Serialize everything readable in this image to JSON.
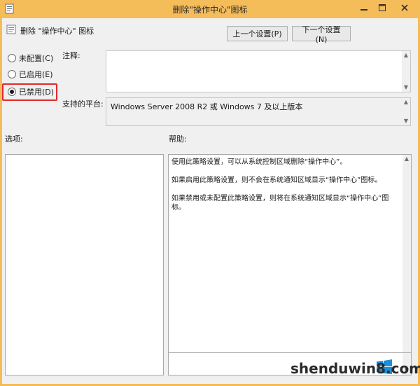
{
  "window": {
    "title": "删除\"操作中心\"图标"
  },
  "header": {
    "policy_name": "删除 \"操作中心\" 图标",
    "prev_button": "上一个设置(P)",
    "next_button": "下一个设置(N)"
  },
  "state_options": {
    "items": [
      {
        "label": "未配置(C)",
        "checked": false
      },
      {
        "label": "已启用(E)",
        "checked": false
      },
      {
        "label": "已禁用(D)",
        "checked": true
      }
    ]
  },
  "comment": {
    "label": "注释:"
  },
  "platform": {
    "label": "支持的平台:",
    "value": "Windows Server 2008 R2 或 Windows 7 及以上版本"
  },
  "options": {
    "label": "选项:"
  },
  "help": {
    "label": "帮助:",
    "paragraphs": [
      "使用此策略设置，可以从系统控制区域删除“操作中心”。",
      "如果启用此策略设置，则不会在系统通知区域显示“操作中心”图标。",
      "如果禁用或未配置此策略设置，则将在系统通知区域显示“操作中心”图标。"
    ]
  },
  "watermark": {
    "text": "shenduwin8.com"
  },
  "colors": {
    "titlebar": "#f5bc5a",
    "highlight": "#e02a2a"
  }
}
